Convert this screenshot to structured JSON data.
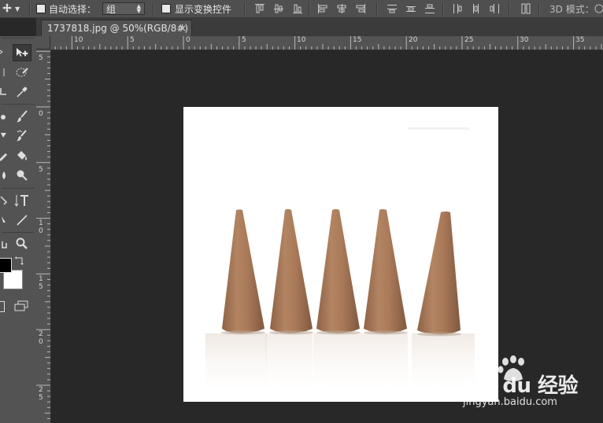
{
  "options_bar": {
    "auto_select_label": "自动选择：",
    "auto_select_value": "组",
    "show_transform_label": "显示变换控件",
    "mode_3d_label": "3D 模式："
  },
  "document_tab": {
    "title": "1737818.jpg @ 50%(RGB/8#)",
    "close_glyph": "×"
  },
  "hruler_labels": [
    "10",
    "5",
    "0",
    "5",
    "10",
    "15",
    "20",
    "25",
    "30",
    "35"
  ],
  "vruler_labels": [
    "5",
    "0",
    "5",
    "1 0",
    "1 5",
    "2 0",
    "2 5"
  ],
  "watermark": {
    "brand": "Bai du 经验",
    "url": "jingyan.baidu.com"
  },
  "colors": {
    "cone": "#a4714e",
    "cone_shadow": "#7d5236",
    "cone_highlight": "#c28d67"
  }
}
